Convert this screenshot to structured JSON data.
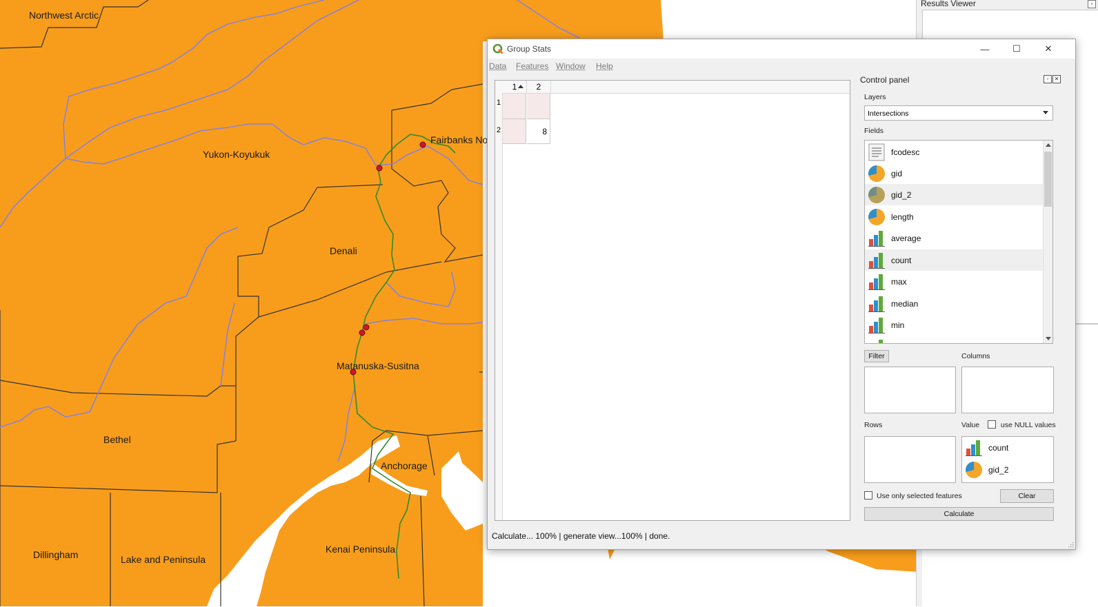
{
  "map": {
    "fill_color": "#F89D1B",
    "border_color": "#333333",
    "river_color": "#8A82D6",
    "route_color": "#2E8B2E",
    "point_color": "#D0152B",
    "water_color": "#FFFFFF",
    "regions": [
      "Northwest Arctic",
      "Yukon-Koyukuk",
      "Fairbanks No",
      "Denali",
      "Matanuska-Susitna",
      "Bethel",
      "Anchorage",
      "Kenai Peninsula",
      "Dillingham",
      "Lake and Peninsula"
    ]
  },
  "results_viewer": {
    "title": "Results Viewer"
  },
  "dialog": {
    "title": "Group Stats",
    "controls": {
      "minimize": "—",
      "maximize": "☐",
      "close": "✕"
    },
    "menu": [
      "Data",
      "Features",
      "Window",
      "Help"
    ]
  },
  "table": {
    "columns": [
      "1",
      "2"
    ],
    "rows": [
      {
        "header": "1",
        "cells": [
          "",
          ""
        ]
      },
      {
        "header": "2",
        "cells": [
          "",
          "8"
        ]
      }
    ]
  },
  "control_panel": {
    "title": "Control panel",
    "layers_label": "Layers",
    "layer_selected": "Intersections",
    "fields_label": "Fields",
    "fields": [
      {
        "name": "fcodesc",
        "icon": "text-field-icon"
      },
      {
        "name": "gid",
        "icon": "pie-chart-icon"
      },
      {
        "name": "gid_2",
        "icon": "pie-chart-icon"
      },
      {
        "name": "length",
        "icon": "pie-chart-icon"
      },
      {
        "name": "average",
        "icon": "bar-chart-icon"
      },
      {
        "name": "count",
        "icon": "bar-chart-icon"
      },
      {
        "name": "max",
        "icon": "bar-chart-icon"
      },
      {
        "name": "median",
        "icon": "bar-chart-icon"
      },
      {
        "name": "min",
        "icon": "bar-chart-icon"
      }
    ],
    "filter_button": "Filter",
    "columns_label": "Columns",
    "rows_label": "Rows",
    "value_label": "Value",
    "use_null_label": "use NULL values",
    "value_items": [
      {
        "name": "count",
        "icon": "bar-chart-icon"
      },
      {
        "name": "gid_2",
        "icon": "pie-chart-icon"
      }
    ],
    "selected_only_label": "Use only selected features",
    "clear_button": "Clear",
    "calculate_button": "Calculate"
  },
  "status": "Calculate... 100% |  generate view...100% |  done."
}
